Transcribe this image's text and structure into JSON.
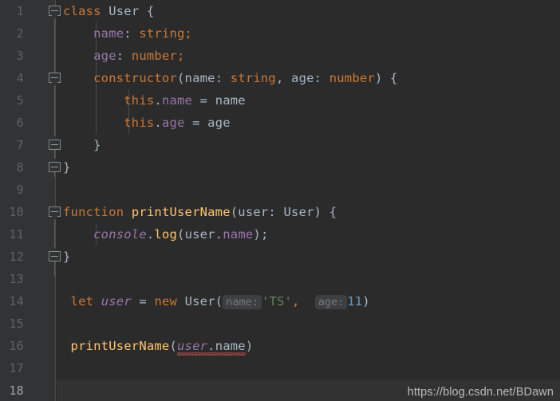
{
  "editor": {
    "theme": "darcula",
    "language": "typescript",
    "background": "#2b2b2b",
    "gutter_background": "#313335",
    "current_line_background": "#323232",
    "current_line": 18,
    "total_lines": 18
  },
  "colors": {
    "keyword": "#cc7832",
    "identifier": "#a9b7c6",
    "field": "#9876aa",
    "function": "#ffc66d",
    "string": "#6a8759",
    "number": "#6897bb",
    "line_number": "#606366",
    "line_number_current": "#a4a3a3",
    "inlay_hint_text": "#787878",
    "inlay_hint_background": "#3d3f41",
    "error_squiggle": "#d25252",
    "indent_guide": "#4b4b4b",
    "fold_marker": "#888888"
  },
  "line_numbers": [
    "1",
    "2",
    "3",
    "4",
    "5",
    "6",
    "7",
    "8",
    "9",
    "10",
    "11",
    "12",
    "13",
    "14",
    "15",
    "16",
    "17",
    "18"
  ],
  "fold_markers": [
    {
      "line": 1,
      "type": "region-start",
      "icon": "fold-minus-down-icon"
    },
    {
      "line": 4,
      "type": "region-start",
      "icon": "fold-minus-down-icon"
    },
    {
      "line": 7,
      "type": "region-end",
      "icon": "fold-minus-up-icon"
    },
    {
      "line": 8,
      "type": "region-end",
      "icon": "fold-minus-up-icon"
    },
    {
      "line": 10,
      "type": "region-start",
      "icon": "fold-minus-down-icon"
    },
    {
      "line": 12,
      "type": "region-end",
      "icon": "fold-minus-up-icon"
    }
  ],
  "code_lines": [
    {
      "n": 1,
      "text": "class User {"
    },
    {
      "n": 2,
      "text": "    name: string;"
    },
    {
      "n": 3,
      "text": "    age: number;"
    },
    {
      "n": 4,
      "text": "    constructor(name: string, age: number) {"
    },
    {
      "n": 5,
      "text": "        this.name = name"
    },
    {
      "n": 6,
      "text": "        this.age = age"
    },
    {
      "n": 7,
      "text": "    }"
    },
    {
      "n": 8,
      "text": "}"
    },
    {
      "n": 9,
      "text": ""
    },
    {
      "n": 10,
      "text": "function printUserName(user: User) {"
    },
    {
      "n": 11,
      "text": "    console.log(user.name);"
    },
    {
      "n": 12,
      "text": "}"
    },
    {
      "n": 13,
      "text": ""
    },
    {
      "n": 14,
      "text": "let user = new User( name: 'TS',  age: 11)"
    },
    {
      "n": 15,
      "text": ""
    },
    {
      "n": 16,
      "text": "printUserName(user.name)"
    },
    {
      "n": 17,
      "text": ""
    },
    {
      "n": 18,
      "text": ""
    }
  ],
  "tokens": {
    "kw_class": "class",
    "name_User": "User",
    "brace_open": " {",
    "field_name": "name",
    "colon": ": ",
    "type_string": "string;",
    "field_age": "age",
    "type_number": "number;",
    "kw_constructor": "constructor",
    "paren_open": "(",
    "param_name": "name",
    "param_type_string": "string",
    "comma": ", ",
    "param_age": "age",
    "param_type_number": "number",
    "paren_close_brace": ") {",
    "kw_this": "this",
    "dot": ".",
    "assign_name": " = name",
    "assign_age": " = age",
    "brace_close": "}",
    "kw_function": "function",
    "fn_printUserName": "printUserName",
    "arg_user": "user",
    "type_User": "User",
    "ident_console": "console",
    "fn_log": "log",
    "prop_name": "name",
    "semi_paren": ");",
    "kw_let": "let",
    "var_user": "user",
    "eq": " = ",
    "kw_new": "new",
    "ctor_User": "User",
    "hint_name": "name:",
    "str_TS": "'TS'",
    "hint_age": "age:",
    "num_11": "11"
  },
  "inlay_hints": [
    {
      "line": 14,
      "label": "name:"
    },
    {
      "line": 14,
      "label": "age:"
    }
  ],
  "diagnostics": [
    {
      "line": 16,
      "range_text": "user.name",
      "severity": "error",
      "decoration": "wavy-underline"
    }
  ],
  "watermark": {
    "text": "https://blog.csdn.net/BDawn"
  }
}
